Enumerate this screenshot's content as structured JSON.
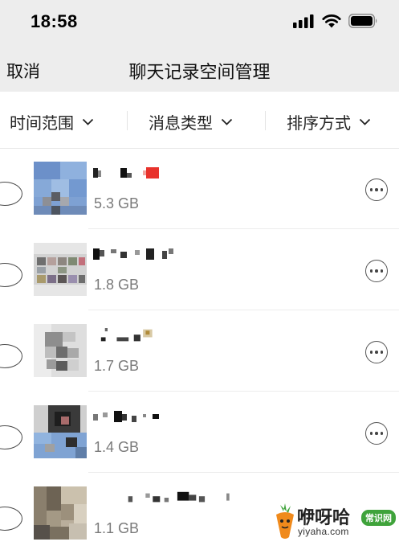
{
  "status_bar": {
    "time": "18:58"
  },
  "nav": {
    "cancel_label": "取消",
    "title": "聊天记录空间管理"
  },
  "filters": [
    {
      "label": "时间范围"
    },
    {
      "label": "消息类型"
    },
    {
      "label": "排序方式"
    }
  ],
  "chats": [
    {
      "size": "5.3 GB"
    },
    {
      "size": "1.8 GB"
    },
    {
      "size": "1.7 GB"
    },
    {
      "size": "1.4 GB"
    },
    {
      "size": "1.1 GB"
    }
  ],
  "watermark": {
    "name": "咿呀哈",
    "badge": "常识网",
    "domain": "yiyaha.com"
  },
  "colors": {
    "header_bg": "#ededed",
    "watermark_green": "#3fa33b"
  }
}
